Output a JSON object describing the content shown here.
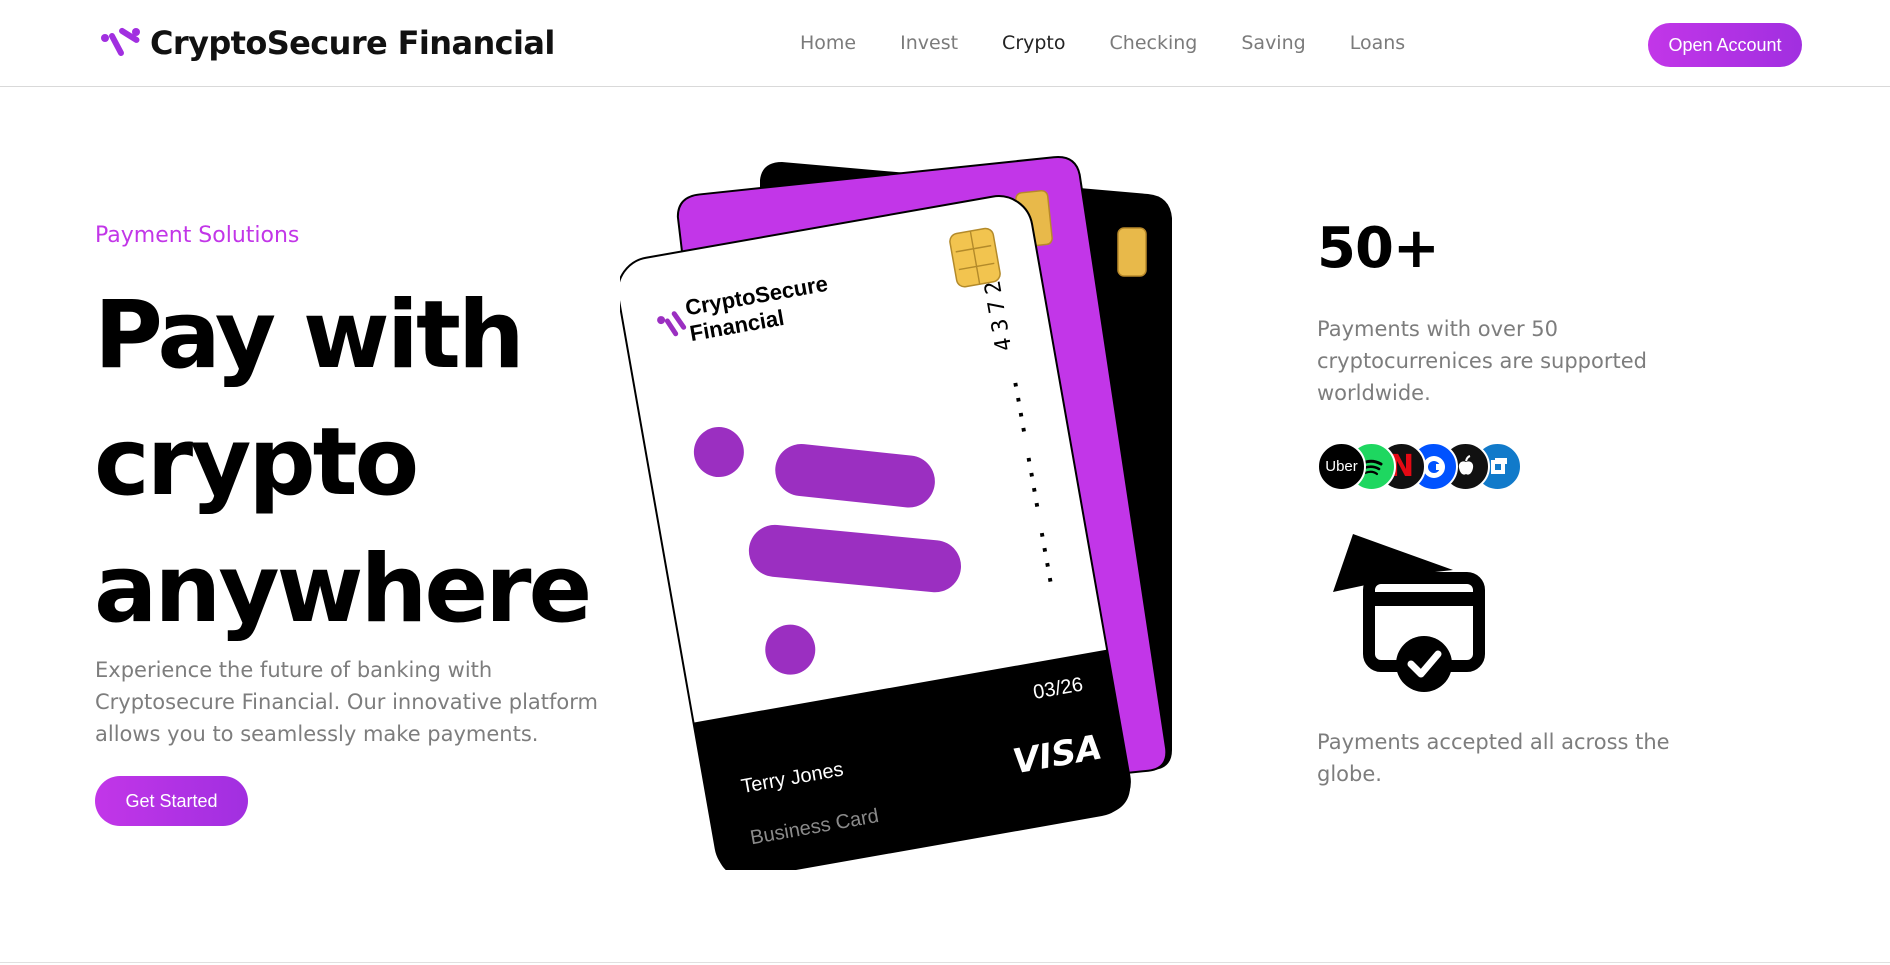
{
  "header": {
    "brand": "CryptoSecure Financial",
    "nav": [
      "Home",
      "Invest",
      "Crypto",
      "Checking",
      "Saving",
      "Loans"
    ],
    "active_nav": "Crypto",
    "cta": "Open Account"
  },
  "hero": {
    "eyebrow": "Payment Solutions",
    "title_lines": [
      "Pay with",
      "crypto",
      "anywhere"
    ],
    "description": "Experience the future of banking with Cryptosecure Financial. Our innovative platform allows you to seamlessly make payments.",
    "cta": "Get Started"
  },
  "card": {
    "brand_line1": "CryptoSecure",
    "brand_line2": "Financial",
    "number": "4372",
    "number_mask": "....  ....  ....",
    "expiry": "03/26",
    "holder": "Terry Jones",
    "type": "Business Card",
    "network": "VISA"
  },
  "stats": {
    "number": "50+",
    "description": "Payments with over 50 cryptocurrenices are supported worldwide.",
    "brands": [
      {
        "name": "Uber",
        "icon": "uber-logo-icon",
        "color": "#000000"
      },
      {
        "name": "Spotify",
        "icon": "spotify-logo-icon",
        "color": "#1ed760"
      },
      {
        "name": "Netflix",
        "icon": "netflix-logo-icon",
        "color": "#111111"
      },
      {
        "name": "Coinbase",
        "icon": "coinbase-logo-icon",
        "color": "#0052ff"
      },
      {
        "name": "Apple",
        "icon": "apple-logo-icon",
        "color": "#111111"
      },
      {
        "name": "Chase",
        "icon": "chase-logo-icon",
        "color": "#117aca"
      }
    ],
    "payment_icon": "card-payment-check-icon",
    "globe_description": "Payments accepted all across the globe."
  },
  "colors": {
    "accent": "#c236e8",
    "accent_dark": "#a12fe0",
    "card_purple": "#9b2fc1",
    "text_muted": "#7d7d7d"
  }
}
